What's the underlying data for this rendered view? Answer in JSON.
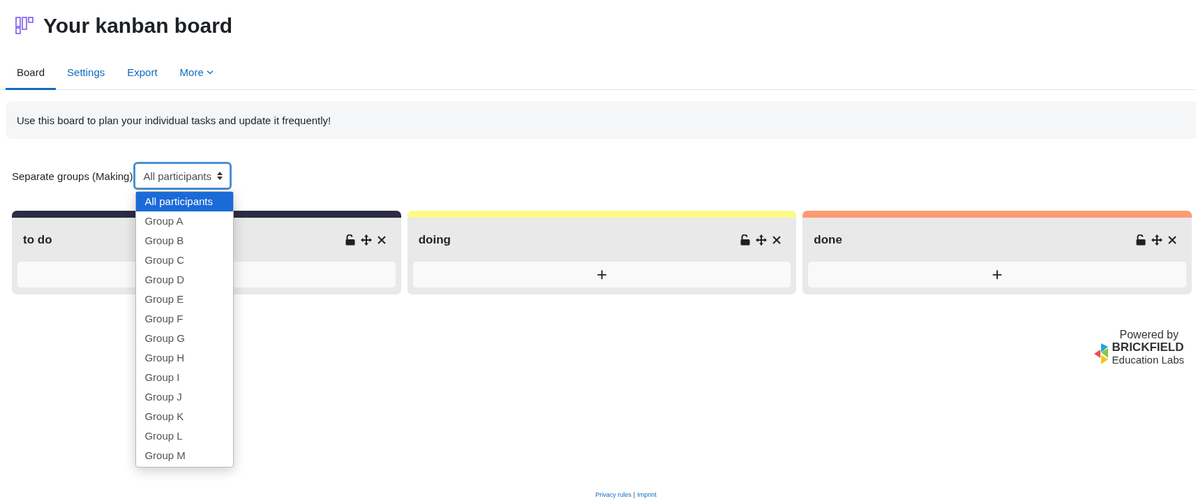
{
  "page": {
    "title": "Your kanban board"
  },
  "tabs": [
    {
      "label": "Board",
      "selected": true
    },
    {
      "label": "Settings",
      "selected": false
    },
    {
      "label": "Export",
      "selected": false
    },
    {
      "label": "More",
      "selected": false,
      "kind": "menu"
    }
  ],
  "info": "Use this board to plan your individual tasks and update it frequently!",
  "group_selector": {
    "label": "Separate groups (Making)",
    "value": "All participants",
    "expanded": true,
    "options": [
      {
        "label": "All participants",
        "selected": true
      },
      {
        "label": "Group A",
        "selected": false
      },
      {
        "label": "Group B",
        "selected": false
      },
      {
        "label": "Group C",
        "selected": false
      },
      {
        "label": "Group D",
        "selected": false
      },
      {
        "label": "Group E",
        "selected": false
      },
      {
        "label": "Group F",
        "selected": false
      },
      {
        "label": "Group G",
        "selected": false
      },
      {
        "label": "Group H",
        "selected": false
      },
      {
        "label": "Group I",
        "selected": false
      },
      {
        "label": "Group J",
        "selected": false
      },
      {
        "label": "Group K",
        "selected": false
      },
      {
        "label": "Group L",
        "selected": false
      },
      {
        "label": "Group M",
        "selected": false
      }
    ]
  },
  "columns": [
    {
      "title": "to do",
      "color": "#2c2c45"
    },
    {
      "title": "doing",
      "color": "#fdfa87",
      "add": "+"
    },
    {
      "title": "done",
      "color": "#fd9b72",
      "add": "+"
    }
  ],
  "branding": {
    "line_1": "Powered by",
    "line_2": "BRICKFIELD",
    "line_3": "Education Labs"
  },
  "footer": {
    "links": [
      "Privacy rules",
      "Imprint"
    ],
    "separator": "|"
  }
}
